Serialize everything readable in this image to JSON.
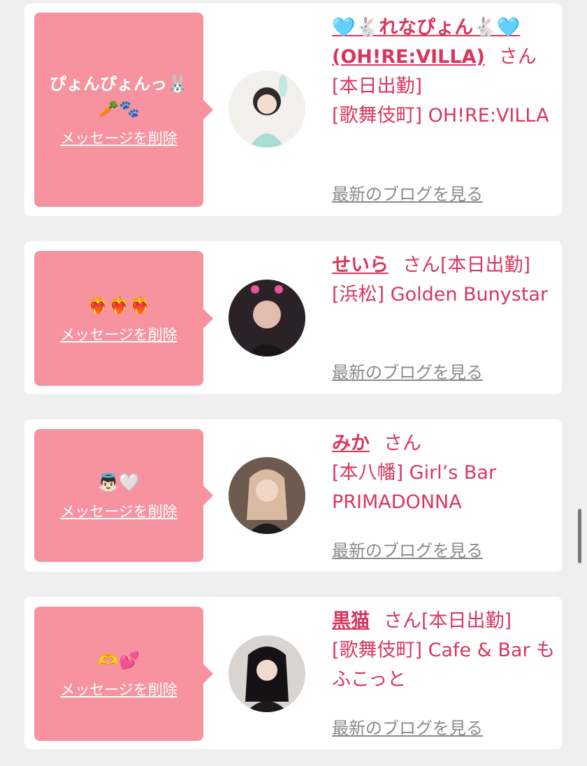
{
  "cards": [
    {
      "message": "ぴょんぴょんっ🐰🥕🐾",
      "delete_label": "メッセージを削除",
      "name": "🩵🐇れなぴょん🐇🩵(OH!RE:VILLA)",
      "honorific": "さん",
      "status": "[本日出勤]",
      "location": "[歌舞伎町] OH!RE:VILLA",
      "blog_link": "最新のブログを見る",
      "avatar": "avatar-photo"
    },
    {
      "message": "❤️‍🔥❤️‍🔥❤️‍🔥",
      "delete_label": "メッセージを削除",
      "name": "せいら",
      "honorific": "さん",
      "status": "[本日出勤]",
      "location": "[浜松] Golden Bunystar",
      "blog_link": "最新のブログを見る",
      "avatar": "avatar-photo"
    },
    {
      "message": "👼🏻🤍",
      "delete_label": "メッセージを削除",
      "name": "みか",
      "honorific": "さん",
      "status": "",
      "location": "[本八幡] Girl’s Bar PRIMADONNA",
      "blog_link": "最新のブログを見る",
      "avatar": "avatar-photo"
    },
    {
      "message": "🫶💕",
      "delete_label": "メッセージを削除",
      "name": "黒猫",
      "honorific": "さん",
      "status": "[本日出勤]",
      "location": "[歌舞伎町] Cafe & Bar もふこっと",
      "blog_link": "最新のブログを見る",
      "avatar": "avatar-photo"
    }
  ],
  "colors": {
    "accent": "#d9365f",
    "bubble": "#f6939f",
    "background": "#efefef",
    "card": "#ffffff",
    "link_gray": "#8a8a8a"
  }
}
